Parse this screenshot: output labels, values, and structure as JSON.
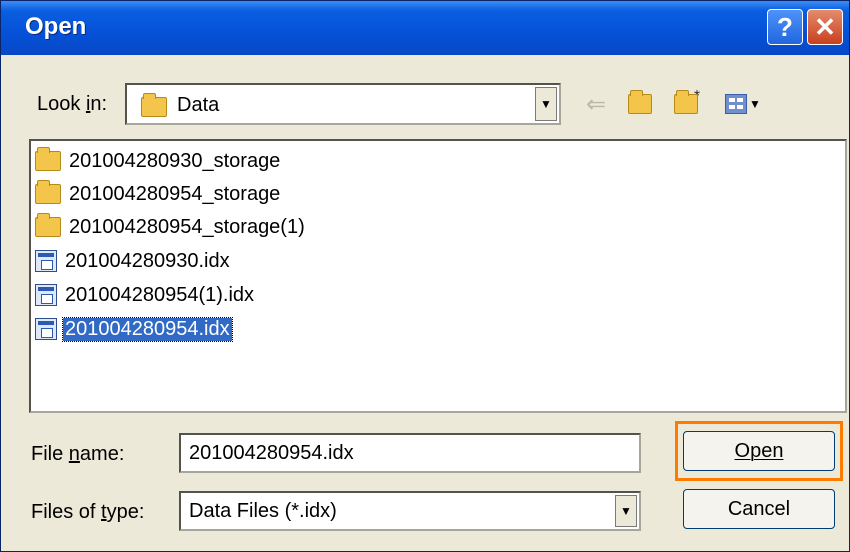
{
  "window": {
    "title": "Open",
    "help_label": "?",
    "close_label": "✕"
  },
  "lookin": {
    "label": "Look in:",
    "value": "Data"
  },
  "toolbar": {
    "back_icon": "back-arrow-icon",
    "up_icon": "up-folder-icon",
    "newfolder_icon": "new-folder-icon",
    "views_icon": "views-menu-icon"
  },
  "files": [
    {
      "name": "201004280930_storage",
      "type": "folder"
    },
    {
      "name": "201004280954_storage",
      "type": "folder"
    },
    {
      "name": "201004280954_storage(1)",
      "type": "folder"
    },
    {
      "name": "201004280930.idx",
      "type": "file"
    },
    {
      "name": "201004280954(1).idx",
      "type": "file"
    },
    {
      "name": "201004280954.idx",
      "type": "file",
      "selected": true
    }
  ],
  "filename": {
    "label": "File name:",
    "value": "201004280954.idx"
  },
  "filetype": {
    "label": "Files of type:",
    "value": "Data Files (*.idx)"
  },
  "buttons": {
    "open": "Open",
    "cancel": "Cancel"
  },
  "colors": {
    "titlebar": "#0551d8",
    "selection": "#316ac5",
    "focus_outline": "#ff7b00"
  }
}
